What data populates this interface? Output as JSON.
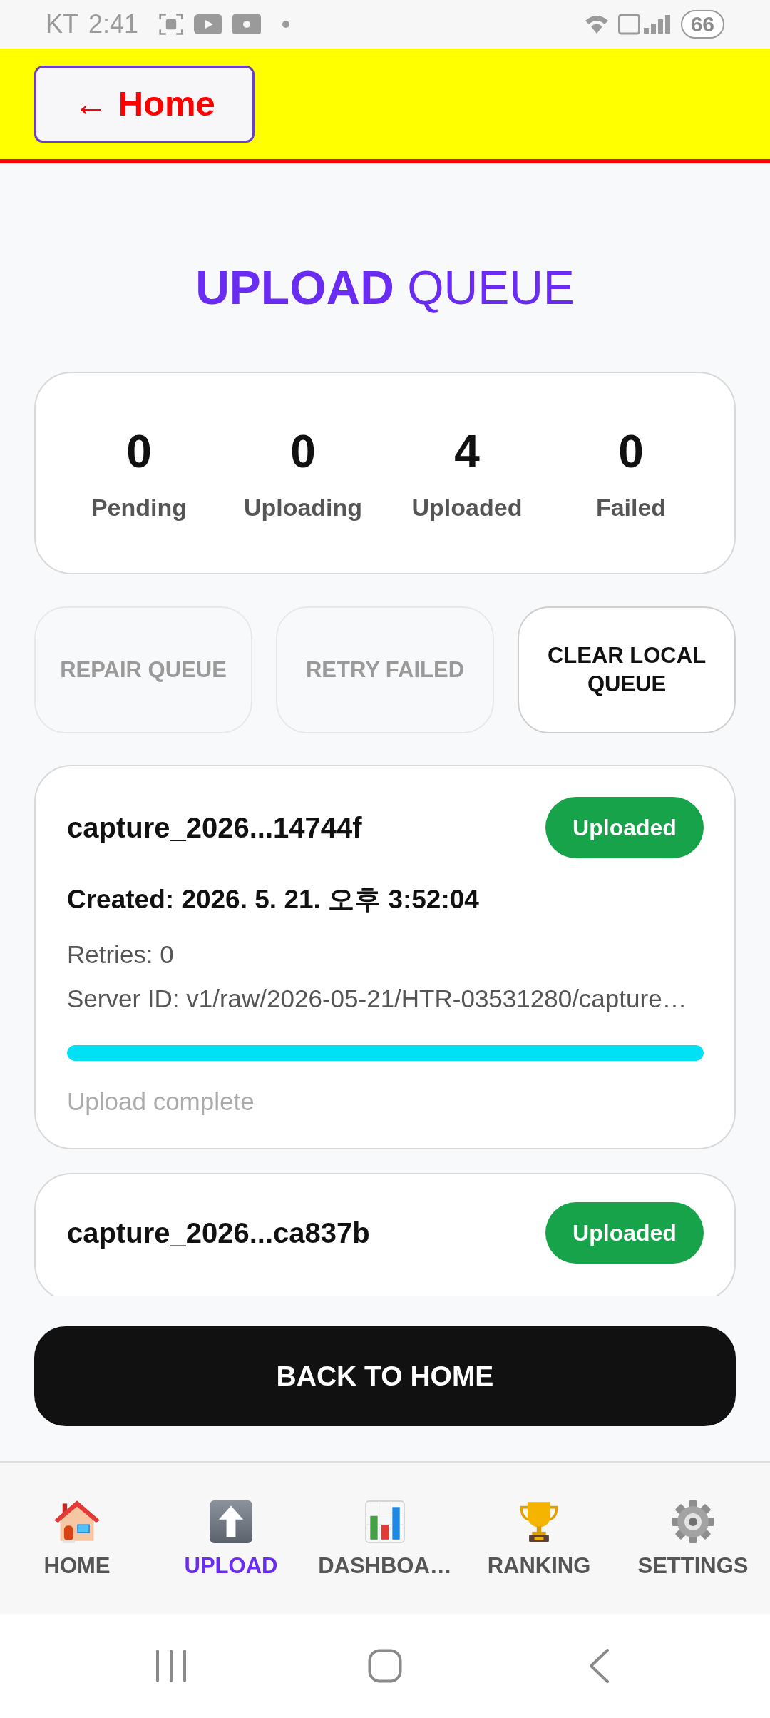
{
  "status_bar": {
    "carrier": "KT",
    "time": "2:41",
    "battery": "66"
  },
  "header": {
    "back_button": "← Home"
  },
  "title": "**UPLOAD** QUEUE",
  "stats": [
    {
      "value": "0",
      "label": "Pending"
    },
    {
      "value": "0",
      "label": "Uploading"
    },
    {
      "value": "4",
      "label": "Uploaded"
    },
    {
      "value": "0",
      "label": "Failed"
    }
  ],
  "actions": [
    {
      "label": "REPAIR QUEUE",
      "disabled": true
    },
    {
      "label": "RETRY FAILED",
      "disabled": true
    },
    {
      "label": "CLEAR LOCAL QUEUE",
      "disabled": false
    }
  ],
  "queue_items": [
    {
      "name": "capture_2026...14744f",
      "status": "Uploaded",
      "created": "Created: 2026. 5. 21. 오후 3:52:04",
      "retries": "Retries: 0",
      "server_id": "Server ID: v1/raw/2026-05-21/HTR-03531280/capture…",
      "level": 1,
      "progress_text": "Upload complete"
    },
    {
      "name": "capture_2026...ca837b",
      "status": "Uploaded"
    }
  ],
  "back_button": "BACK TO HOME",
  "tabs": [
    {
      "label": "HOME",
      "selected": false
    },
    {
      "label": "UPLOAD",
      "selected": true
    },
    {
      "label": "DASHBOA…",
      "selected": false
    },
    {
      "label": "RANKING",
      "selected": false
    },
    {
      "label": "SETTINGS",
      "selected": false
    }
  ]
}
